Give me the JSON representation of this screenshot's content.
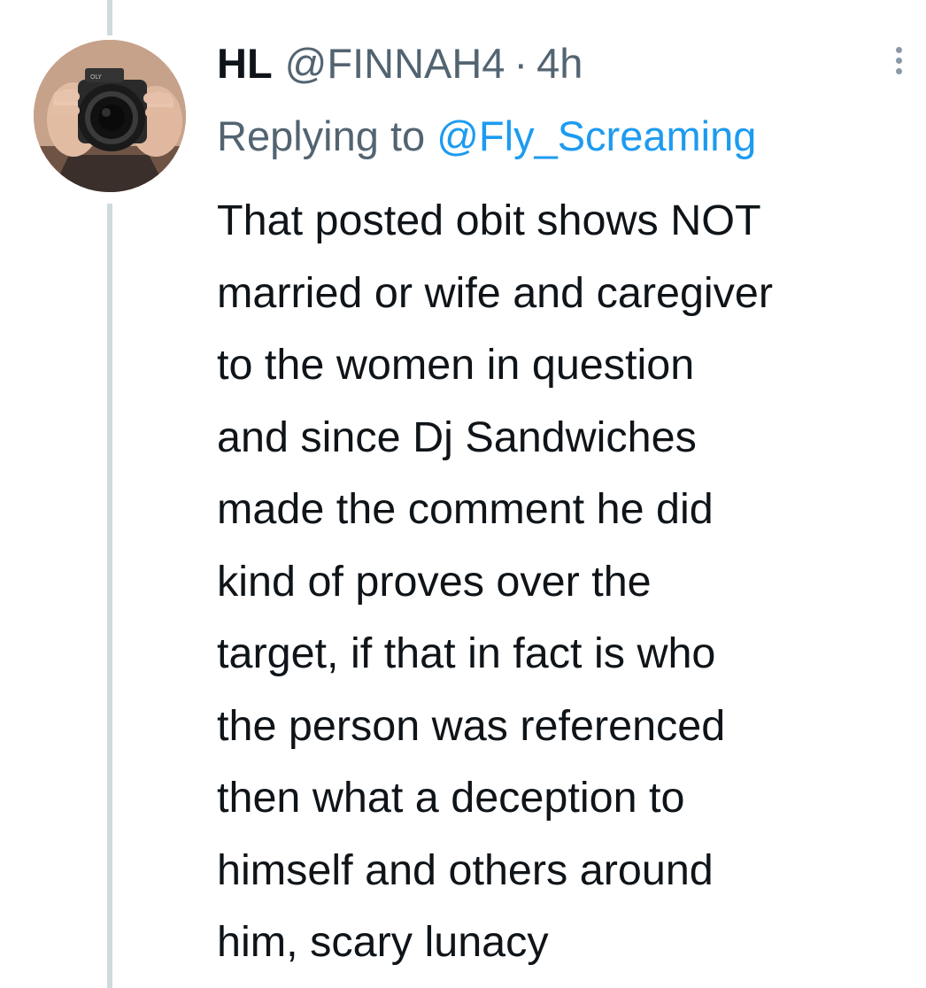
{
  "tweet": {
    "display_name": "HL",
    "handle": "@FINNAH4",
    "separator": "·",
    "time": "4h",
    "replying_prefix": "Replying to",
    "replying_to": "@Fly_Screaming",
    "avatar_icon": "camera-photographer-avatar",
    "more_icon": "more-vertical-icon",
    "text_lines": [
      "That posted obit shows NOT",
      "married or wife and caregiver",
      "to the women in question",
      "and since Dj Sandwiches",
      "made the comment he did",
      "kind of proves over the",
      "target, if that in fact is who",
      "the person was referenced",
      "then what a deception to",
      "himself and others around",
      "him, scary lunacy"
    ]
  },
  "colors": {
    "text_primary": "#0f1419",
    "text_secondary": "#536471",
    "link": "#1d9bf0",
    "thread_line": "#cfd9de"
  }
}
